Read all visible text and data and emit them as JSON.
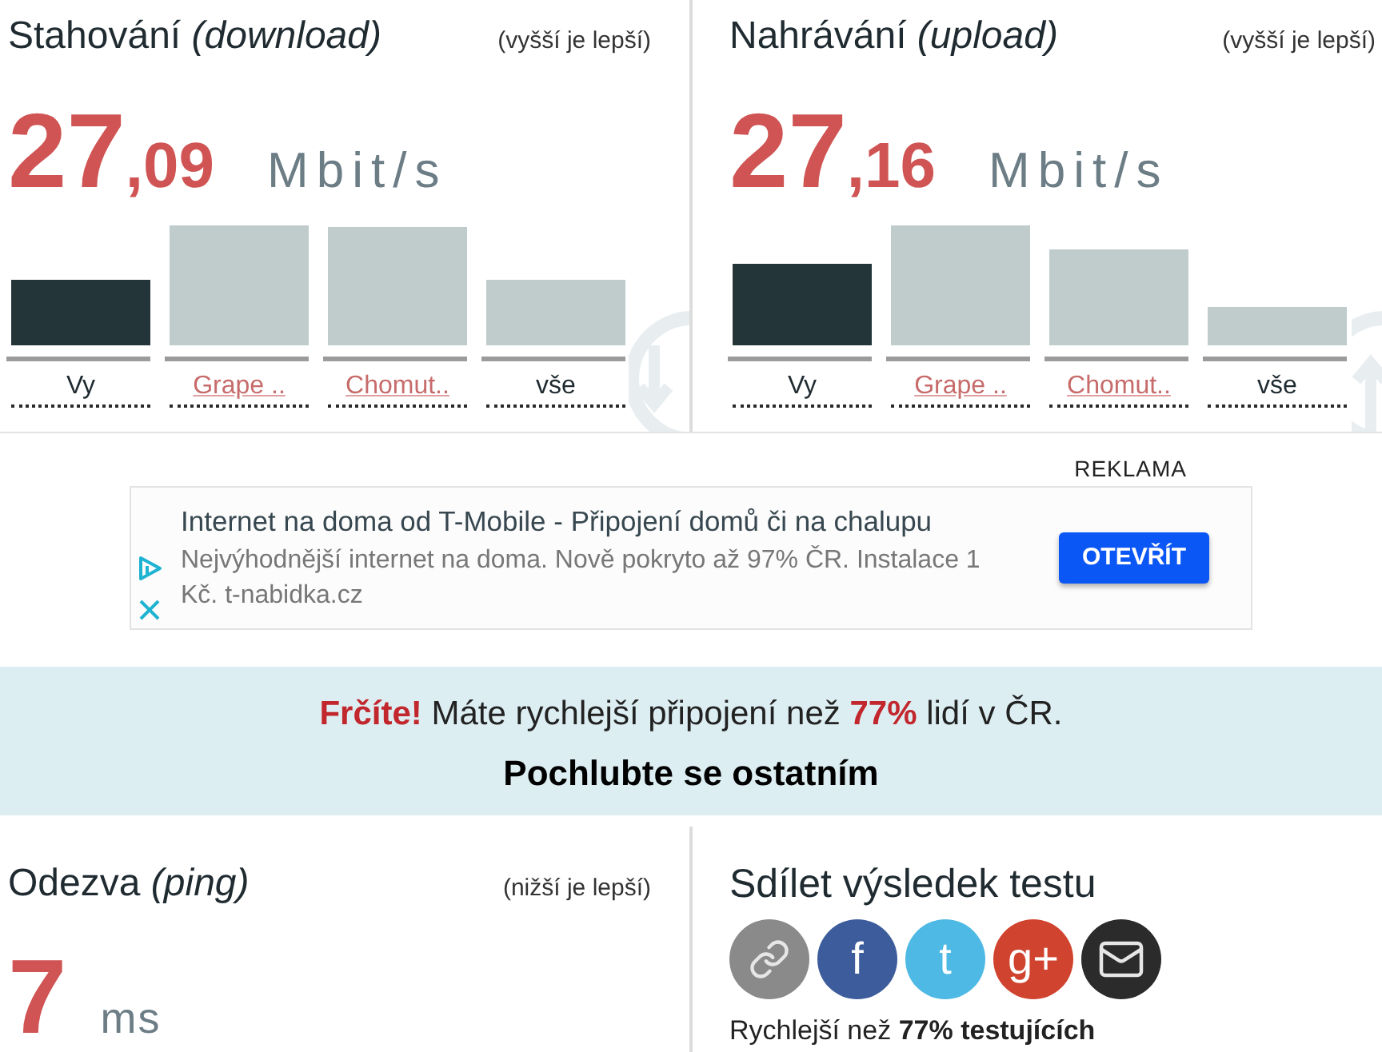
{
  "panels": [
    {
      "title": "Stahování *(download)*",
      "hint": "(vyšší je lepší)",
      "value_whole": "27",
      "value_fraction": ",09",
      "unit": "Mbit/s",
      "kind": "download",
      "bars": [
        {
          "label": "Vy",
          "kind": "self"
        },
        {
          "label": "Grape ..",
          "kind": "link"
        },
        {
          "label": "Chomut..",
          "kind": "link"
        },
        {
          "label": "vše",
          "kind": "all"
        }
      ]
    },
    {
      "title": "Nahrávání *(upload)*",
      "hint": "(vyšší je lepší)",
      "value_whole": "27",
      "value_fraction": ",16",
      "unit": "Mbit/s",
      "kind": "upload",
      "bars": [
        {
          "label": "Vy",
          "kind": "self"
        },
        {
          "label": "Grape ..",
          "kind": "link"
        },
        {
          "label": "Chomut..",
          "kind": "link"
        },
        {
          "label": "vše",
          "kind": "all"
        }
      ]
    }
  ],
  "ad": {
    "label": "REKLAMA",
    "title": "Internet na doma od T-Mobile - Připojení domů či na chalupu",
    "description": "Nejvýhodnější internet na doma. Nově pokryto až 97% ČR. Instalace 1 Kč. t-nabidka.cz",
    "button": "OTEVŘÍT"
  },
  "banner": {
    "message": "**Frčíte!** Máte rychlejší připojení než **77%** lidí v ČR.",
    "call_to_action": "Pochlubte se ostatním"
  },
  "ping": {
    "title": "Odezva *(ping)*",
    "hint": "(nižší je lepší)",
    "value": "7",
    "unit": "ms"
  },
  "share": {
    "title": "Sdílet výsledek testu",
    "buttons": [
      {
        "kind": "link",
        "color": "#8a8a8a"
      },
      {
        "kind": "text",
        "label": "f",
        "color": "#3d5c9c"
      },
      {
        "kind": "text",
        "label": "t",
        "color": "#4db9e4"
      },
      {
        "kind": "text",
        "label": "g+",
        "color": "#d0432e"
      },
      {
        "kind": "mail",
        "color": "#2b2b2b"
      }
    ],
    "summary": "Rychlejší než **77% testujících**"
  }
}
